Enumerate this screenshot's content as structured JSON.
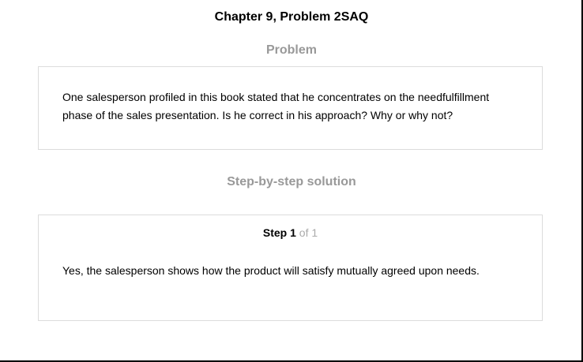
{
  "header": {
    "title": "Chapter 9, Problem 2SAQ"
  },
  "problem": {
    "heading": "Problem",
    "text": "One salesperson profiled in this book stated that he concentrates on the needfulfillment phase of the sales presentation. Is he correct in his approach? Why or why not?"
  },
  "solution": {
    "heading": "Step-by-step solution",
    "step_word": "Step",
    "step_number": "1",
    "step_total": "of 1",
    "text": "Yes, the salesperson shows how the product will satisfy mutually agreed upon needs."
  }
}
